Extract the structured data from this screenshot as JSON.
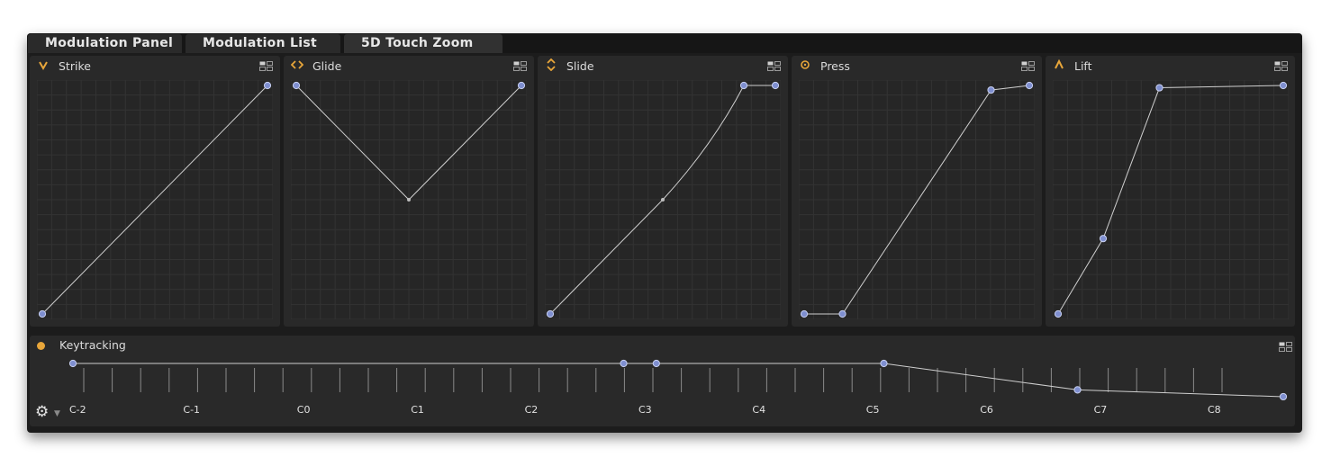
{
  "tabs": [
    {
      "label": "Modulation Panel"
    },
    {
      "label": "Modulation List"
    },
    {
      "label": "5D Touch Zoom"
    }
  ],
  "panels": [
    {
      "title": "Strike",
      "icon": "v",
      "icon_name": "strike-icon",
      "points": [
        [
          0,
          0
        ],
        [
          1,
          1
        ]
      ],
      "handles": []
    },
    {
      "title": "Glide",
      "icon": "<>",
      "icon_name": "glide-icon",
      "points": [
        [
          0,
          1
        ],
        [
          0.5,
          0.5
        ],
        [
          1,
          1
        ]
      ],
      "handles": [
        1
      ]
    },
    {
      "title": "Slide",
      "icon": "^v",
      "icon_name": "slide-icon",
      "points": [
        [
          0,
          0
        ],
        [
          0.5,
          0.5
        ],
        [
          0.86,
          1
        ],
        [
          1,
          1
        ]
      ],
      "handles": [
        1
      ]
    },
    {
      "title": "Press",
      "icon": "o",
      "icon_name": "press-icon",
      "points": [
        [
          0,
          0
        ],
        [
          0.17,
          0
        ],
        [
          0.83,
          0.98
        ],
        [
          1,
          1
        ]
      ],
      "handles": []
    },
    {
      "title": "Lift",
      "icon": "^",
      "icon_name": "lift-icon",
      "points": [
        [
          0,
          0
        ],
        [
          0.2,
          0.33
        ],
        [
          0.45,
          0.99
        ],
        [
          1,
          1
        ]
      ],
      "handles": []
    }
  ],
  "keytracking": {
    "title": "Keytracking",
    "notes": [
      "C-2",
      "C-1",
      "C0",
      "C1",
      "C2",
      "C3",
      "C4",
      "C5",
      "C6",
      "C7",
      "C8"
    ],
    "points": [
      [
        0,
        1
      ],
      [
        0.455,
        1
      ],
      [
        0.482,
        1
      ],
      [
        0.67,
        1
      ],
      [
        0.83,
        0.11
      ],
      [
        1,
        -0.12
      ]
    ]
  },
  "colors": {
    "accent": "#e8a63a",
    "point": "#7f8fd0",
    "line": "#cfcfcf"
  }
}
